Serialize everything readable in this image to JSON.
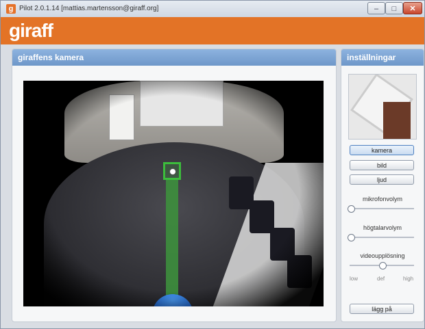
{
  "window": {
    "title": "Pilot 2.0.1.14 [mattias.martensson@giraff.org]",
    "app_icon_glyph": "g",
    "controls": {
      "minimize": "‒",
      "maximize": "□",
      "close": "✕"
    }
  },
  "brand": {
    "logo_text": "giraff",
    "color": "#e37326"
  },
  "camera_panel": {
    "title": "giraffens kamera",
    "accent": "#3d8f3d"
  },
  "settings_panel": {
    "title": "inställningar",
    "buttons": {
      "camera": "kamera",
      "image": "bild",
      "sound": "ljud",
      "hangup": "lägg på"
    },
    "sliders": {
      "microphone": {
        "label": "mikrofonvolym",
        "value": 0.0
      },
      "speaker": {
        "label": "högtalarvolym",
        "value": 0.0
      },
      "resolution": {
        "label": "videoupplösning",
        "value": 0.5,
        "ticks": [
          "low",
          "def",
          "high"
        ]
      }
    }
  }
}
